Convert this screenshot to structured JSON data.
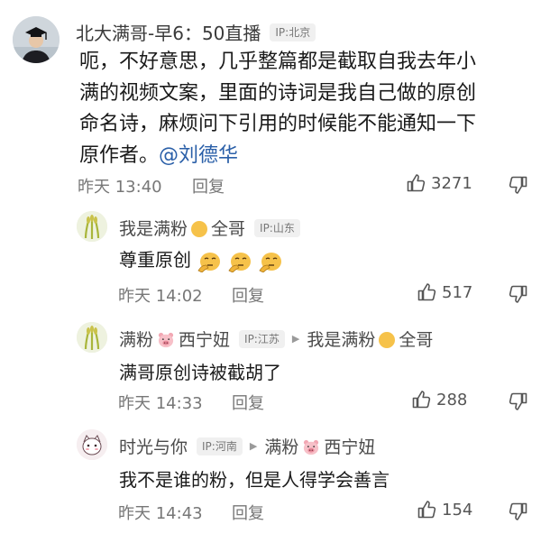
{
  "main_comment": {
    "author": "北大满哥-早6：50直播",
    "ip": "IP:北京",
    "text_lines": [
      "呃，不好意思，几乎整篇都是截取自我去年小",
      "满的视频文案，里面的诗词是我自己做的原创",
      "命名诗，麻烦问下引用的时候能不能通知一下"
    ],
    "text_last": "原作者。",
    "mention": "@刘德华",
    "time": "昨天 13:40",
    "reply_label": "回复",
    "likes": "3271"
  },
  "replies": [
    {
      "author": "我是满粉",
      "author_suffix": "全哥",
      "ip": "IP:山东",
      "text": "尊重原创",
      "time": "昨天 14:02",
      "reply_label": "回复",
      "likes": "517"
    },
    {
      "author": "满粉",
      "author_suffix": "西宁妞",
      "ip": "IP:江苏",
      "reply_to": "我是满粉",
      "reply_to_suffix": "全哥",
      "text": "满哥原创诗被截胡了",
      "time": "昨天 14:33",
      "reply_label": "回复",
      "likes": "288"
    },
    {
      "author": "时光与你",
      "ip": "IP:河南",
      "reply_to": "满粉",
      "reply_to_suffix": "西宁妞",
      "text": "我不是谁的粉，但是人得学会善言",
      "time": "昨天 14:43",
      "reply_label": "回复",
      "likes": "154"
    }
  ],
  "icons": {
    "like": "thumbs-up-icon",
    "dislike": "thumbs-down-icon",
    "reply_arrow": "triangle-right-icon",
    "emoji_face": "smile-emoji-icon",
    "pig": "pig-emoji-icon",
    "thinker": "thinking-emoji-icon"
  },
  "colors": {
    "mention": "#2a5fa8",
    "meta_text": "#777777",
    "ip_badge_bg": "#f0f0f0"
  }
}
